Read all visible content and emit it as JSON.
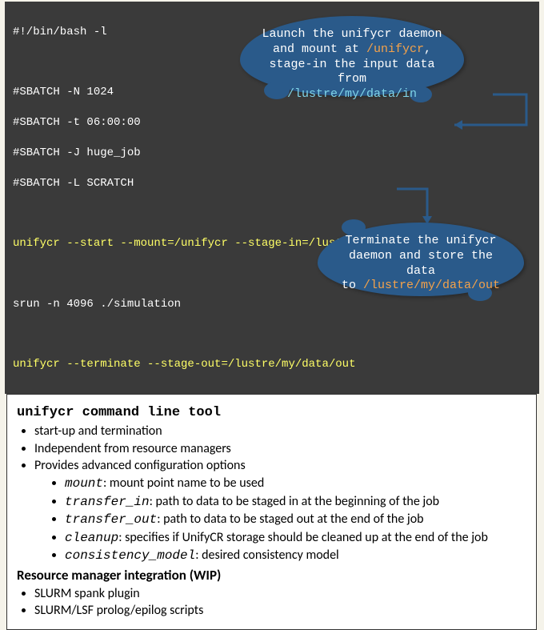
{
  "code": {
    "shebang": "#!/bin/bash -l",
    "sbatch1": "#SBATCH -N 1024",
    "sbatch2": "#SBATCH -t 06:00:00",
    "sbatch3": "#SBATCH -J huge_job",
    "sbatch4": "#SBATCH -L SCRATCH",
    "unifycr_start": "unifycr --start --mount=/unifycr --stage-in=/lustre/my/data/in",
    "srun": "srun -n 4096 ./simulation",
    "unifycr_term": "unifycr --terminate --stage-out=/lustre/my/data/out"
  },
  "callout_top": {
    "l1": "Launch the unifycr daemon",
    "l2a": "and mount at ",
    "l2b": "/unifycr",
    "l2c": ",",
    "l3": "stage-in the input data from",
    "l4": "/lustre/my/data/in"
  },
  "callout_bottom": {
    "l1": "Terminate the unifycr",
    "l2": "daemon and store the data",
    "l3a": "to ",
    "l3b": "/lustre/my/data/out"
  },
  "info": {
    "heading1": "unifycr command line tool",
    "b1": "start-up and termination",
    "b2": "Independent from resource managers",
    "b3": "Provides advanced configuration options",
    "opts": {
      "mount_k": "mount",
      "mount_v": ": mount point name to be used",
      "tin_k": "transfer_in",
      "tin_v": ": path to data to be staged in at the beginning of the job",
      "tout_k": "transfer_out",
      "tout_v": ": path to data to be staged out at the end of the job",
      "clean_k": "cleanup",
      "clean_v": ": specifies if UnifyCR storage should be cleaned up at the end of the job",
      "cm_k": "consistency_model",
      "cm_v": ": desired consistency model"
    },
    "heading2": "Resource manager integration (WIP)",
    "r1": "SLURM spank plugin",
    "r2": "SLURM/LSF prolog/epilog scripts"
  }
}
